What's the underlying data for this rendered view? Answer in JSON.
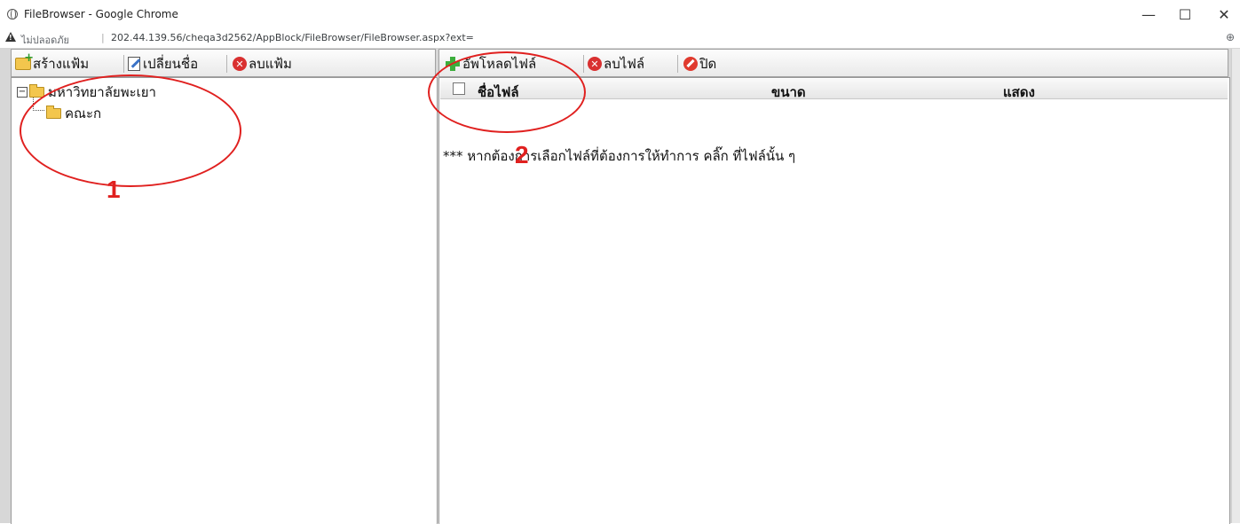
{
  "window": {
    "title": "FileBrowser - Google Chrome",
    "controls": {
      "minimize": "—",
      "maximize": "☐",
      "close": "✕"
    }
  },
  "addressbar": {
    "security_label": "ไม่ปลอดภัย",
    "separator": "|",
    "url": "202.44.139.56/cheqa3d2562/AppBlock/FileBrowser/FileBrowser.aspx?ext=",
    "zoom_icon": "⊕"
  },
  "folder_toolbar": {
    "create_folder": "สร้างแฟ้ม",
    "rename": "เปลี่ยนชื่อ",
    "delete_folder": "ลบแฟ้ม"
  },
  "file_toolbar": {
    "upload": "อัพโหลดไฟล์",
    "delete_file": "ลบไฟล์",
    "close": "ปิด"
  },
  "tree": {
    "expander": "−",
    "root": "มหาวิทยาลัยพะเยา",
    "children": [
      "คณะก"
    ]
  },
  "grid": {
    "headers": {
      "name": "ชื่อไฟล์",
      "size": "ขนาด",
      "show": "แสดง"
    },
    "hint": "*** หากต้องการเลือกไฟล์ที่ต้องการให้ทำการ คลิ๊ก ที่ไฟล์นั้น ๆ"
  },
  "annotations": {
    "one": "1",
    "two": "2",
    "color": "#e0201f"
  }
}
